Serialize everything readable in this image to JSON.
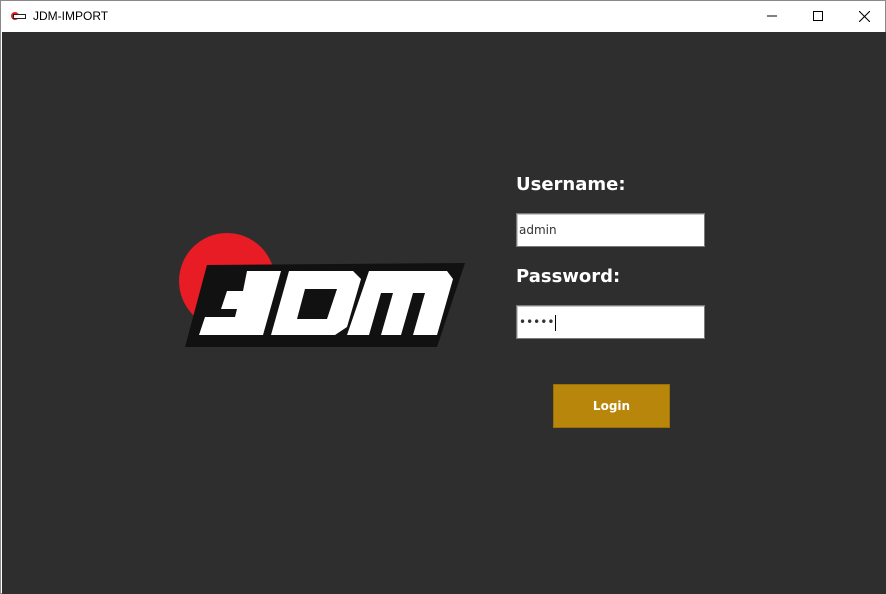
{
  "window": {
    "title": "JDM-IMPORT",
    "controls": [
      "minimize",
      "maximize",
      "close"
    ]
  },
  "logo": {
    "text": "JDM",
    "sun_color": "#e81c24",
    "text_color": "#ffffff",
    "outline_color": "#111111"
  },
  "form": {
    "username_label": "Username:",
    "username_value": "admin",
    "password_label": "Password:",
    "password_value": "•••••",
    "login_label": "Login"
  },
  "colors": {
    "background": "#2e2e2e",
    "button": "#b8860b"
  }
}
